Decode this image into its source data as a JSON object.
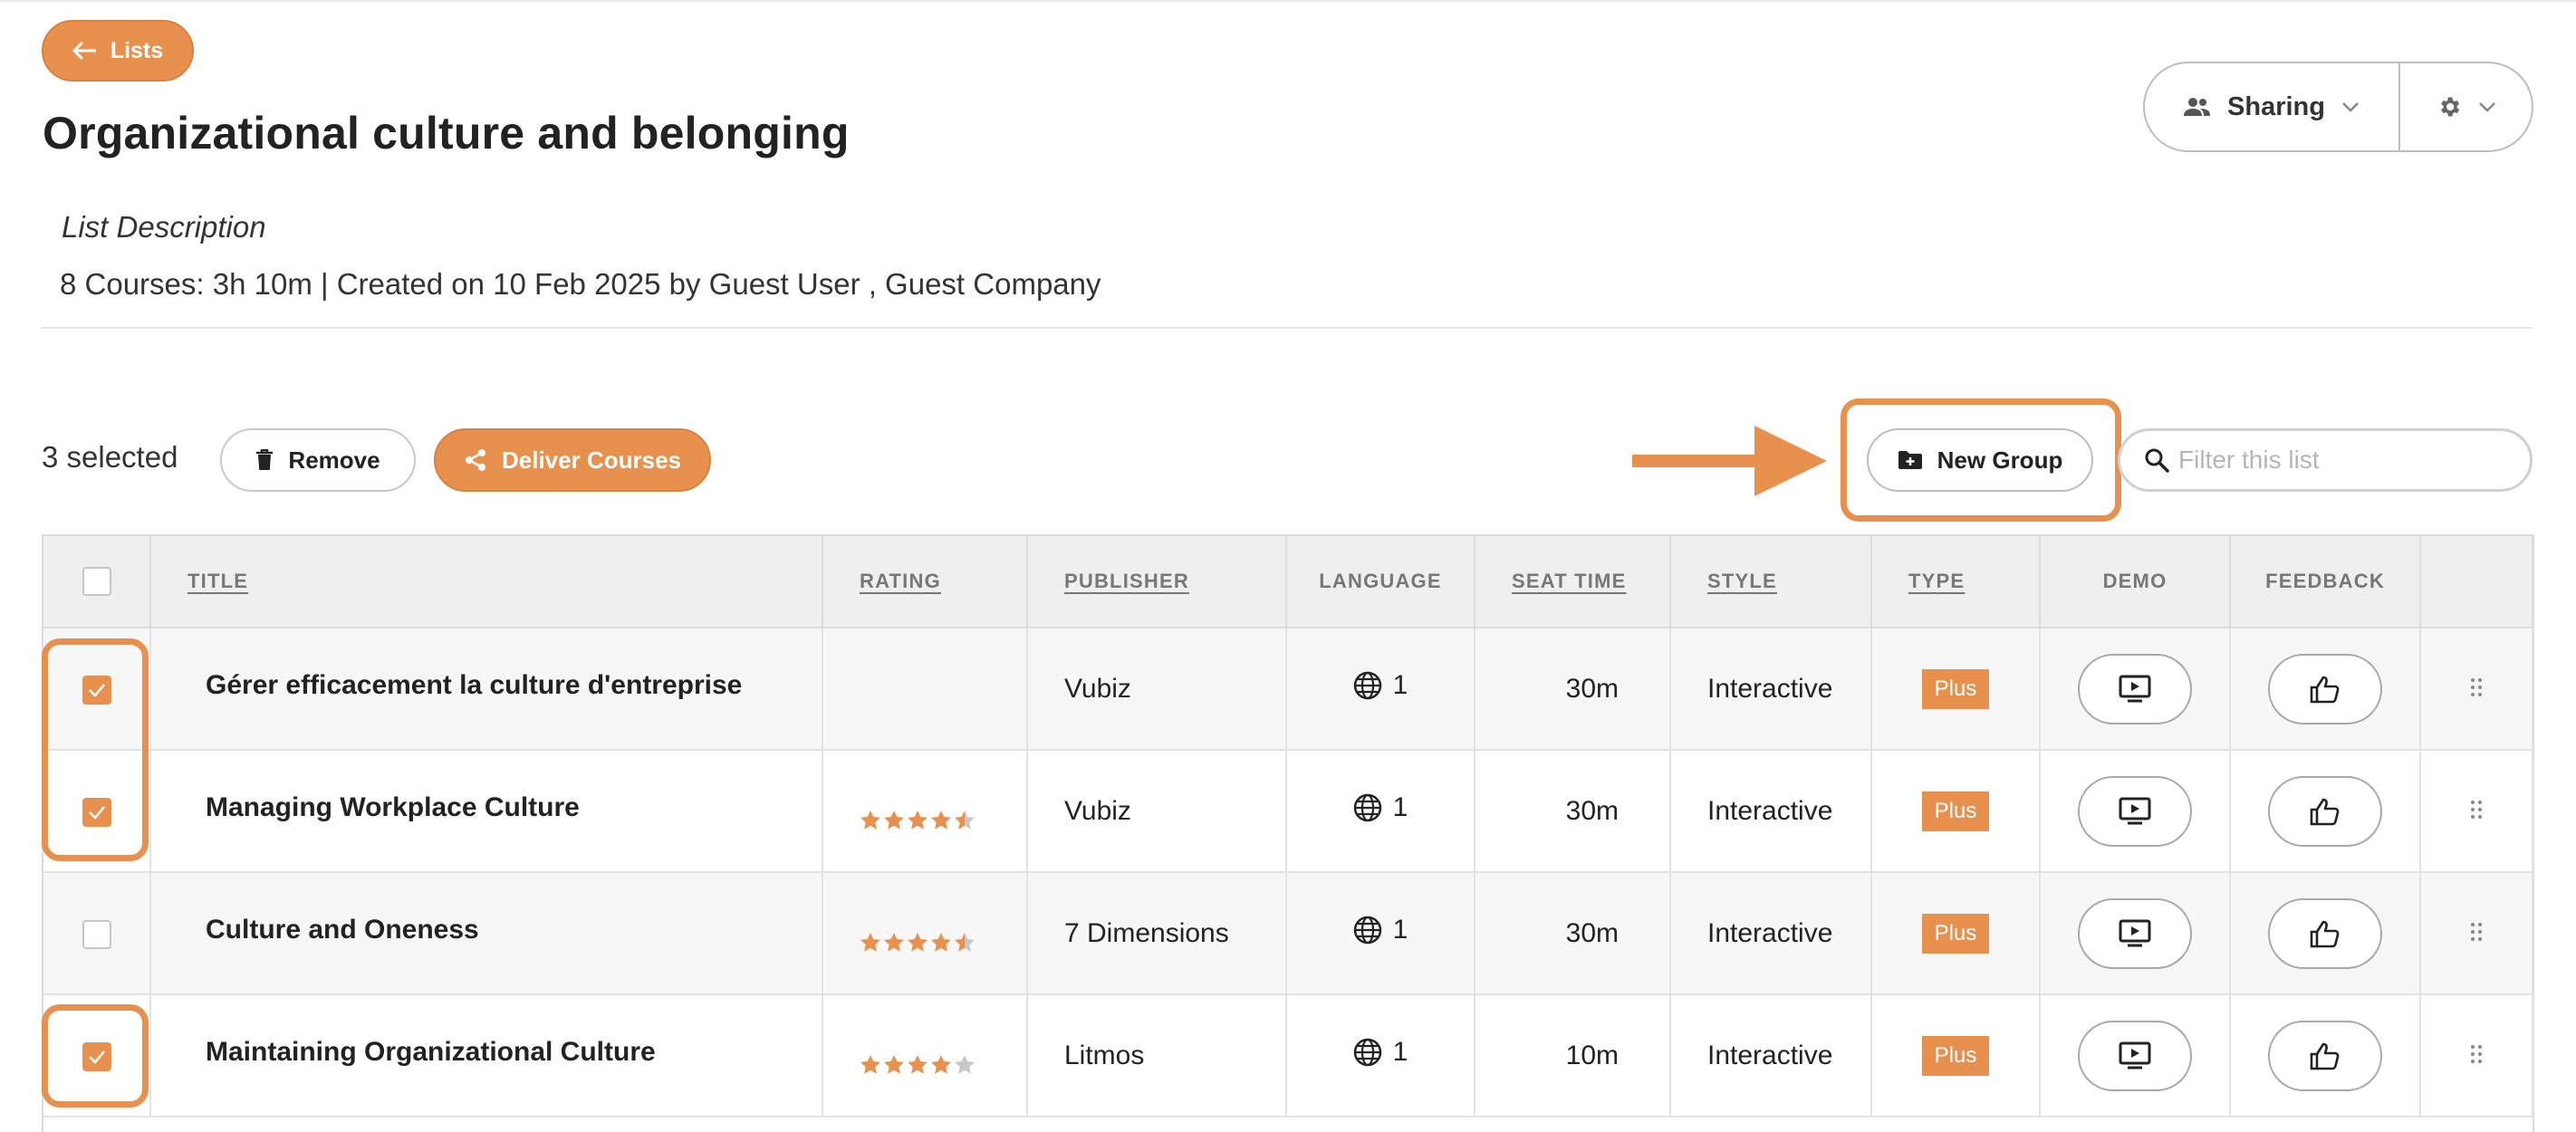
{
  "nav": {
    "back_label": "Lists"
  },
  "page": {
    "title": "Organizational culture and belonging",
    "description_label": "List Description",
    "meta": "8 Courses: 3h 10m | Created on 10 Feb 2025 by Guest User , Guest Company"
  },
  "header_actions": {
    "sharing_label": "Sharing"
  },
  "toolbar": {
    "selected_count": "3 selected",
    "remove_label": "Remove",
    "deliver_label": "Deliver Courses",
    "new_group_label": "New Group",
    "filter_placeholder": "Filter this list"
  },
  "table": {
    "columns": [
      "Title",
      "Rating",
      "Publisher",
      "Language",
      "Seat Time",
      "Style",
      "Type",
      "Demo",
      "Feedback"
    ],
    "rows": [
      {
        "selected": true,
        "title": "Gérer efficacement la culture d'entreprise",
        "rating": null,
        "publisher": "Vubiz",
        "language_count": "1",
        "seat_time": "30m",
        "style": "Interactive",
        "type": "Plus"
      },
      {
        "selected": true,
        "title": "Managing Workplace Culture",
        "rating": 4.5,
        "publisher": "Vubiz",
        "language_count": "1",
        "seat_time": "30m",
        "style": "Interactive",
        "type": "Plus"
      },
      {
        "selected": false,
        "title": "Culture and Oneness",
        "rating": 4.5,
        "publisher": "7 Dimensions",
        "language_count": "1",
        "seat_time": "30m",
        "style": "Interactive",
        "type": "Plus"
      },
      {
        "selected": true,
        "title": "Maintaining Organizational Culture",
        "rating": 4,
        "publisher": "Litmos",
        "language_count": "1",
        "seat_time": "10m",
        "style": "Interactive",
        "type": "Plus"
      }
    ]
  },
  "colors": {
    "accent": "#e8914f",
    "header_bg": "#efefef",
    "row_alt": "#f7f7f7"
  },
  "icons": [
    "arrow-left-icon",
    "people-icon",
    "chevron-down-icon",
    "gear-icon",
    "trash-icon",
    "share-icon",
    "folder-plus-icon",
    "search-icon",
    "globe-icon",
    "play-screen-icon",
    "thumbs-up-icon",
    "drag-handle-icon",
    "star-icon",
    "checkmark-icon",
    "pointer-arrow"
  ]
}
